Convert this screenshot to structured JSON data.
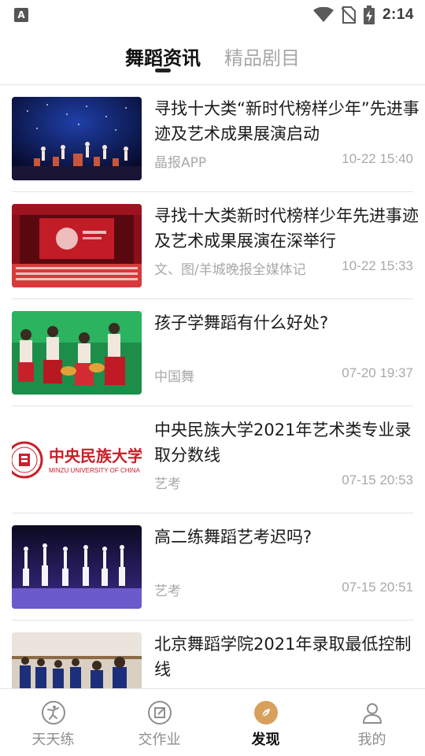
{
  "status_bar": {
    "app_icon_letter": "A",
    "time": "2:14",
    "icons": [
      "wifi-icon",
      "no-sim-icon",
      "battery-icon"
    ]
  },
  "top_tabs": [
    {
      "label": "舞蹈资讯",
      "active": true
    },
    {
      "label": "精品剧目",
      "active": false
    }
  ],
  "news": [
    {
      "title": "寻找十大类“新时代榜样少年”先进事迹及艺术成果展演启动",
      "source": "晶报APP",
      "time": "10-22 15:40"
    },
    {
      "title": "寻找十大类新时代榜样少年先进事迹及艺术成果展演在深举行",
      "source": "文、图/羊城晚报全媒体记",
      "time": "10-22 15:33"
    },
    {
      "title": "孩子学舞蹈有什么好处?",
      "source": "中国舞",
      "time": "07-20 19:37"
    },
    {
      "title": "中央民族大学2021年艺术类专业录取分数线",
      "source": "艺考",
      "time": "07-15 20:53",
      "thumb_logo_cn": "中央民族大学",
      "thumb_logo_en": "MINZU UNIVERSITY OF CHINA"
    },
    {
      "title": "高二练舞蹈艺考迟吗?",
      "source": "艺考",
      "time": "07-15 20:51"
    },
    {
      "title": "北京舞蹈学院2021年录取最低控制线",
      "source": "",
      "time": ""
    }
  ],
  "bottom_nav": [
    {
      "label": "天天练",
      "icon": "dancer-icon",
      "active": false
    },
    {
      "label": "交作业",
      "icon": "edit-icon",
      "active": false
    },
    {
      "label": "发现",
      "icon": "compass-icon",
      "active": true
    },
    {
      "label": "我的",
      "icon": "profile-icon",
      "active": false
    }
  ],
  "colors": {
    "accent": "#d9a05b",
    "text_primary": "#1b1b1b",
    "text_secondary": "#a9a9a9",
    "divider": "#e3e3e3"
  }
}
